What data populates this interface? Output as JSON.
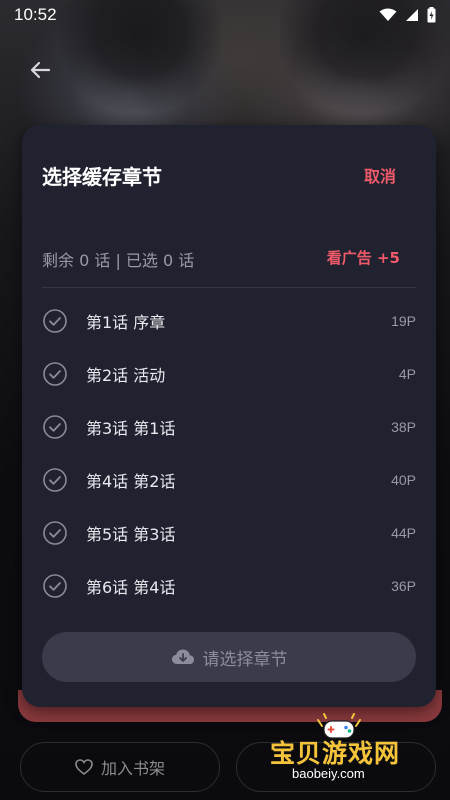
{
  "status_bar": {
    "time": "10:52"
  },
  "sheet": {
    "title": "选择缓存章节",
    "cancel_label": "取消",
    "summary": "剩余 0 话 | 已选 0 话",
    "ad_label": "看广告 +5",
    "chapters": [
      {
        "title": "第1话 序章",
        "pages": "19P"
      },
      {
        "title": "第2话 活动",
        "pages": "4P"
      },
      {
        "title": "第3话 第1话",
        "pages": "38P"
      },
      {
        "title": "第4话 第2话",
        "pages": "40P"
      },
      {
        "title": "第5话 第3话",
        "pages": "44P"
      },
      {
        "title": "第6话 第4话",
        "pages": "36P"
      }
    ],
    "confirm_label": "请选择章节"
  },
  "bottom_bar": {
    "shelf_label": "加入书架"
  },
  "watermark": {
    "title": "宝贝游戏网",
    "subtitle": "baobeiy.com"
  },
  "colors": {
    "accent": "#ef5a6a",
    "sheet_bg": "#21222f",
    "watermark": "#f6c43a"
  },
  "icons": [
    "back-arrow-icon",
    "wifi-icon",
    "signal-icon",
    "battery-icon",
    "check-circle-icon",
    "cloud-download-icon",
    "heart-icon",
    "gamepad-icon"
  ]
}
